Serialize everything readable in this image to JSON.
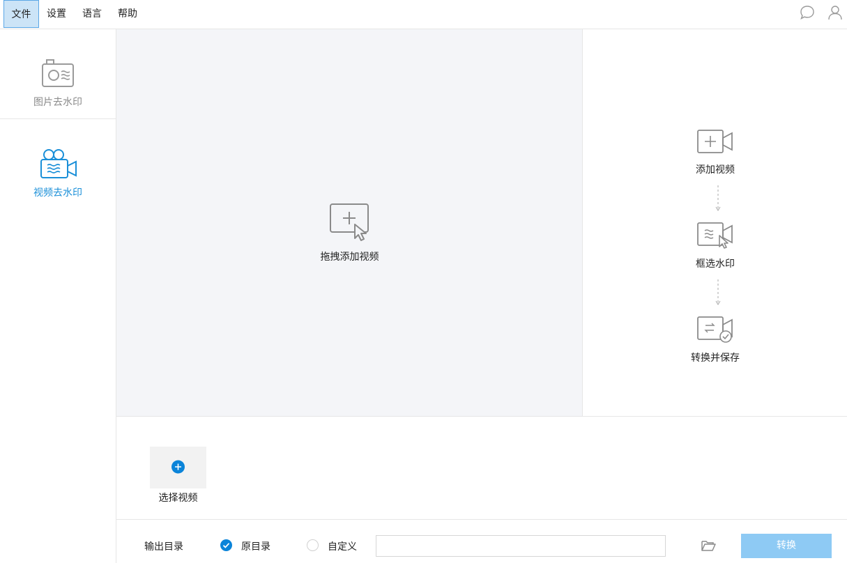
{
  "menubar": {
    "items": [
      {
        "label": "文件",
        "active": true
      },
      {
        "label": "设置",
        "active": false
      },
      {
        "label": "语言",
        "active": false
      },
      {
        "label": "帮助",
        "active": false
      }
    ],
    "icons": [
      "chat-icon",
      "user-icon"
    ]
  },
  "sidebar": {
    "items": [
      {
        "label": "图片去水印",
        "icon": "photo-watermark-icon",
        "active": false
      },
      {
        "label": "视频去水印",
        "icon": "video-watermark-icon",
        "active": true
      }
    ]
  },
  "droparea": {
    "label": "拖拽添加视频",
    "icon": "add-video-drop-icon"
  },
  "steps": [
    {
      "label": "添加视频",
      "icon": "add-video-icon"
    },
    {
      "label": "框选水印",
      "icon": "select-watermark-icon"
    },
    {
      "label": "转换并保存",
      "icon": "convert-save-icon"
    }
  ],
  "filelist": {
    "choose_label": "选择视频"
  },
  "output": {
    "label": "输出目录",
    "option_original": "原目录",
    "option_custom": "自定义",
    "selected": "original",
    "path_value": "",
    "convert_label": "转换"
  },
  "colors": {
    "accent": "#0b84d9",
    "accent_light": "#8ecaf4",
    "active_menu_bg": "#cce4f7",
    "drop_bg": "#f4f5f8",
    "sidebar_active_text": "#1a8fd8",
    "sidebar_inactive_text": "#8a8a8a"
  }
}
